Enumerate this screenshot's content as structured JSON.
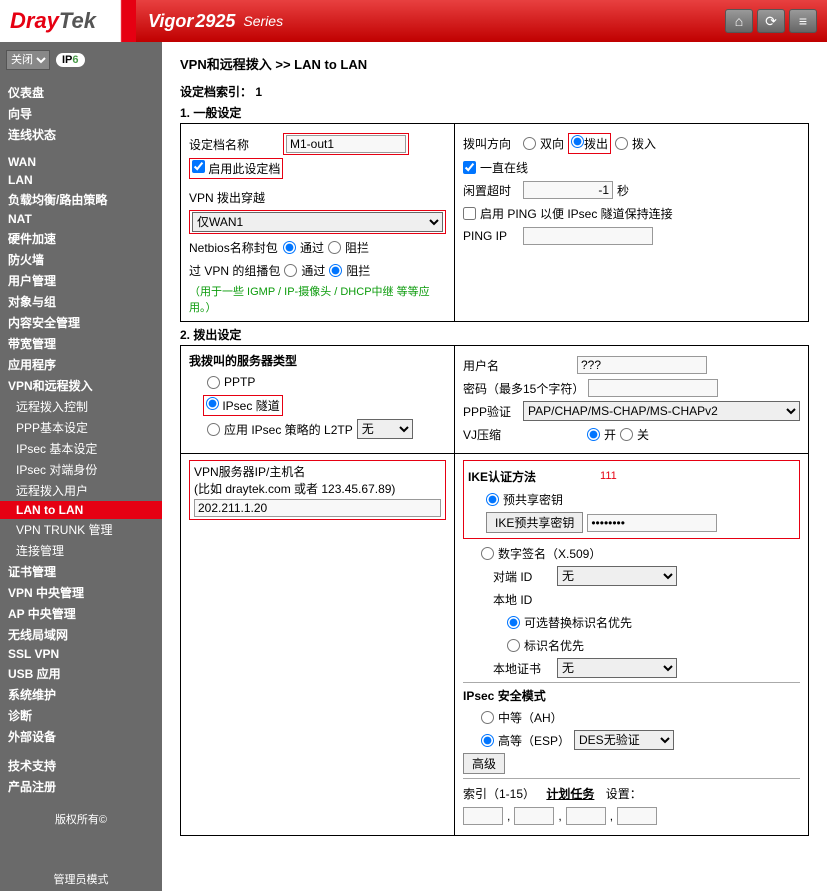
{
  "header": {
    "logo_a": "Dray",
    "logo_b": "Tek",
    "model": "Vigor",
    "model_num": "2925",
    "series": "Series"
  },
  "sidebar": {
    "lang": "关闭",
    "ipv6": "IP",
    "items": [
      "仪表盘",
      "向导",
      "连线状态",
      "",
      "WAN",
      "LAN",
      "负载均衡/路由策略",
      "NAT",
      "硬件加速",
      "防火墙",
      "用户管理",
      "对象与组",
      "内容安全管理",
      "带宽管理",
      "应用程序",
      "VPN和远程拨入",
      "远程拨入控制",
      "PPP基本设定",
      "IPsec 基本设定",
      "IPsec 对端身份",
      "远程拨入用户",
      "LAN to LAN",
      "VPN TRUNK 管理",
      "连接管理",
      "证书管理",
      "VPN 中央管理",
      "AP 中央管理",
      "无线局域网",
      "SSL VPN",
      "USB 应用",
      "系统维护",
      "诊断",
      "外部设备",
      "",
      "技术支持",
      "产品注册"
    ],
    "copyright": "版权所有©",
    "adminmode": "管理员模式"
  },
  "breadcrumb": {
    "a": "VPN和远程拨入",
    "sep": ">>",
    "b": "LAN to LAN"
  },
  "index_label": "设定档索引：",
  "index_val": "1",
  "sec1": {
    "title": "1. 一般设定",
    "profile_name_lbl": "设定档名称",
    "profile_name": "M1-out1",
    "enable_lbl": "启用此设定档",
    "dialthrough_lbl": "VPN 拨出穿越",
    "dialthrough_val": "仅WAN1",
    "netbios_lbl": "Netbios名称封包",
    "pass": "通过",
    "block": "阻拦",
    "multicast_lbl": "过 VPN 的组播包",
    "note": "（用于一些 IGMP / IP-摄像头 / DHCP中继 等等应用。）",
    "dir_lbl": "拨叫方向",
    "dir_both": "双向",
    "dir_out": "拨出",
    "dir_in": "拨入",
    "always_on": "一直在线",
    "idle_lbl": "闲置超时",
    "idle_val": "-1",
    "idle_unit": "秒",
    "ping_keep": "启用 PING 以便 IPsec 隧道保持连接",
    "ping_ip_lbl": "PING IP"
  },
  "sec2": {
    "title": "2. 拨出设定",
    "srv_type": "我拨叫的服务器类型",
    "pptp": "PPTP",
    "ipsec": "IPsec 隧道",
    "l2tp": "应用 IPsec 策略的 L2TP",
    "l2tp_val": "无",
    "host_lbl": "VPN服务器IP/主机名",
    "host_hint": "(比如 draytek.com 或者 123.45.67.89)",
    "host_val": "202.211.1.20",
    "user_lbl": "用户名",
    "user_val": "???",
    "pwd_lbl": "密码（最多15个字符）",
    "ppp_lbl": "PPP验证",
    "ppp_val": "PAP/CHAP/MS-CHAP/MS-CHAPv2",
    "vj_lbl": "VJ压缩",
    "on": "开",
    "off": "关",
    "ike_title": "IKE认证方法",
    "ike_note": "111",
    "psk": "预共享密钥",
    "psk_btn": "IKE预共享密钥",
    "psk_val": "••••••••",
    "sig": "数字签名（X.509）",
    "peer_id": "对端 ID",
    "local_id": "本地 ID",
    "r1": "可选替换标识名优先",
    "r2": "标识名优先",
    "local_cert": "本地证书",
    "none": "无",
    "sec_title": "IPsec 安全模式",
    "ah": "中等（AH）",
    "esp": "高等（ESP）",
    "esp_val": "DES无验证",
    "adv": "高级",
    "sched": "索引（1-15）",
    "sched2": "计划任务",
    "sched3": "设置："
  }
}
